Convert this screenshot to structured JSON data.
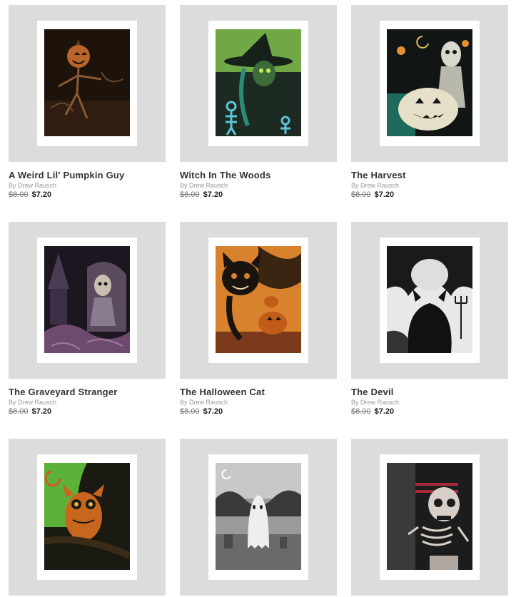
{
  "products": [
    {
      "title": "A Weird Lil' Pumpkin Guy",
      "author": "By Drew Rausch",
      "old_price": "$8.00",
      "new_price": "$7.20",
      "art": "pumpkin-guy-art"
    },
    {
      "title": "Witch In The Woods",
      "author": "By Drew Rausch",
      "old_price": "$8.00",
      "new_price": "$7.20",
      "art": "witch-art"
    },
    {
      "title": "The Harvest",
      "author": "By Drew Rausch",
      "old_price": "$8.00",
      "new_price": "$7.20",
      "art": "harvest-art"
    },
    {
      "title": "The Graveyard Stranger",
      "author": "By Drew Rausch",
      "old_price": "$8.00",
      "new_price": "$7.20",
      "art": "graveyard-art"
    },
    {
      "title": "The Halloween Cat",
      "author": "By Drew Rausch",
      "old_price": "$8.00",
      "new_price": "$7.20",
      "art": "halloween-cat-art"
    },
    {
      "title": "The Devil",
      "author": "By Drew Rausch",
      "old_price": "$8.00",
      "new_price": "$7.20",
      "art": "devil-art"
    },
    {
      "art": "owl-art"
    },
    {
      "art": "ghost-art"
    },
    {
      "art": "skeleton-art"
    }
  ]
}
